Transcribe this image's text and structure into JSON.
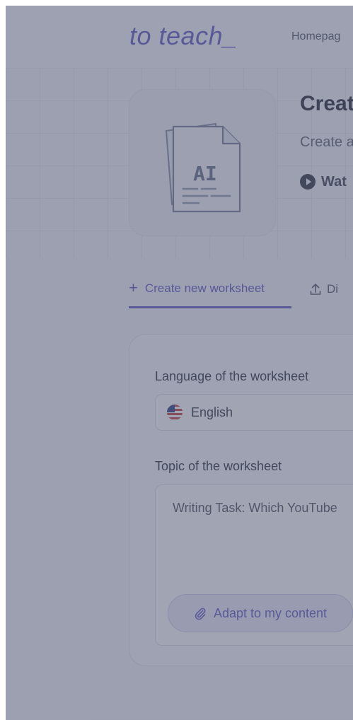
{
  "header": {
    "logo": "to teach_",
    "nav_home": "Homepag"
  },
  "hero": {
    "title": "Creat",
    "subtitle": "Create a",
    "watch_label": "Wat",
    "icon_text": "AI"
  },
  "tabs": [
    {
      "label": "Create new worksheet",
      "icon": "plus-icon",
      "active": true
    },
    {
      "label": "Di",
      "icon": "upload-icon",
      "active": false
    }
  ],
  "form": {
    "language_label": "Language of the worksheet",
    "language_value": "English",
    "language_flag": "us-flag-icon",
    "topic_label": "Topic of the worksheet",
    "topic_value": "Writing Task: Which YouTube",
    "adapt_button": "Adapt to my content"
  },
  "colors": {
    "accent": "#6b63c9",
    "overlay": "#4a506c"
  }
}
